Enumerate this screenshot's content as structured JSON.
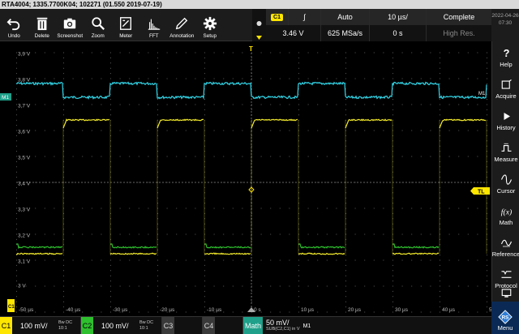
{
  "title": "RTA4004; 1335.7700K04; 102271 (01.550 2019-07-19)",
  "toolbar": [
    {
      "label": "Undo",
      "icon": "undo-icon"
    },
    {
      "label": "Delete",
      "icon": "trash-icon"
    },
    {
      "label": "Screenshot",
      "icon": "camera-icon"
    },
    {
      "label": "Zoom",
      "icon": "zoom-icon"
    },
    {
      "label": "Meter",
      "icon": "meter-icon"
    },
    {
      "label": "FFT",
      "icon": "fft-icon"
    },
    {
      "label": "Annotation",
      "icon": "pen-icon"
    },
    {
      "label": "Setup",
      "icon": "gear-icon"
    }
  ],
  "status": {
    "channel": "C1",
    "slope": "∫",
    "trigger_mode": "Auto",
    "time_scale": "10 µs/",
    "acq_state": "Complete",
    "trigger_level": "3.46 V",
    "sample_rate": "625 MSa/s",
    "time_offset": "0 s",
    "resolution": "High Res."
  },
  "clock": {
    "date": "2022-04-26",
    "time": "07:30"
  },
  "sidebar": [
    {
      "label": "Help",
      "icon": "help-icon"
    },
    {
      "label": "Acquire",
      "icon": "acquire-icon"
    },
    {
      "label": "History",
      "icon": "play-icon"
    },
    {
      "label": "Measure",
      "icon": "measure-icon"
    },
    {
      "label": "Cursor",
      "icon": "cursor-icon"
    },
    {
      "label": "Math",
      "icon": "math-icon"
    },
    {
      "label": "Reference",
      "icon": "reference-icon"
    },
    {
      "label": "Protocol",
      "icon": "protocol-icon"
    },
    {
      "label": "Apps",
      "icon": "apps-icon"
    }
  ],
  "menu_label": "Menu",
  "grid": {
    "y_labels": [
      "3,9 V",
      "3,8 V",
      "3,7 V",
      "3,6 V",
      "3,5 V",
      "3,4 V",
      "3,3 V",
      "3,2 V",
      "3,1 V",
      "3 V"
    ],
    "x_labels": [
      "-50 µs",
      "-40 µs",
      "-30 µs",
      "-20 µs",
      "-10 µs",
      "0 s",
      "10 µs",
      "20 µs",
      "30 µs",
      "40 µs",
      "50 µs"
    ],
    "markers": {
      "m1_left": "M1",
      "m1_right": "M1",
      "tl": "TL",
      "t": "T",
      "c1": "C1"
    }
  },
  "traces": {
    "cyan_color": "#33d6e8",
    "yellow_color": "#f2ea2b",
    "green_color": "#2ec02e"
  },
  "channels": [
    {
      "name": "C1",
      "scale": "100 mV/",
      "coupling_top": "Bᴡ DC",
      "coupling_bot": "10:1",
      "color": "#ffe600",
      "active": true
    },
    {
      "name": "C2",
      "scale": "100 mV/",
      "coupling_top": "Bᴡ DC",
      "coupling_bot": "10:1",
      "color": "#2ec02e",
      "active": true
    },
    {
      "name": "C3",
      "scale": "",
      "coupling_top": "",
      "coupling_bot": "",
      "color": "#555555",
      "active": false
    },
    {
      "name": "C4",
      "scale": "",
      "coupling_top": "",
      "coupling_bot": "",
      "color": "#555555",
      "active": false
    }
  ],
  "math": {
    "name": "Math",
    "scale": "50 mV/",
    "expr": "SUB(C2,C1) in V",
    "label": "M1",
    "color": "#1fa08a"
  }
}
